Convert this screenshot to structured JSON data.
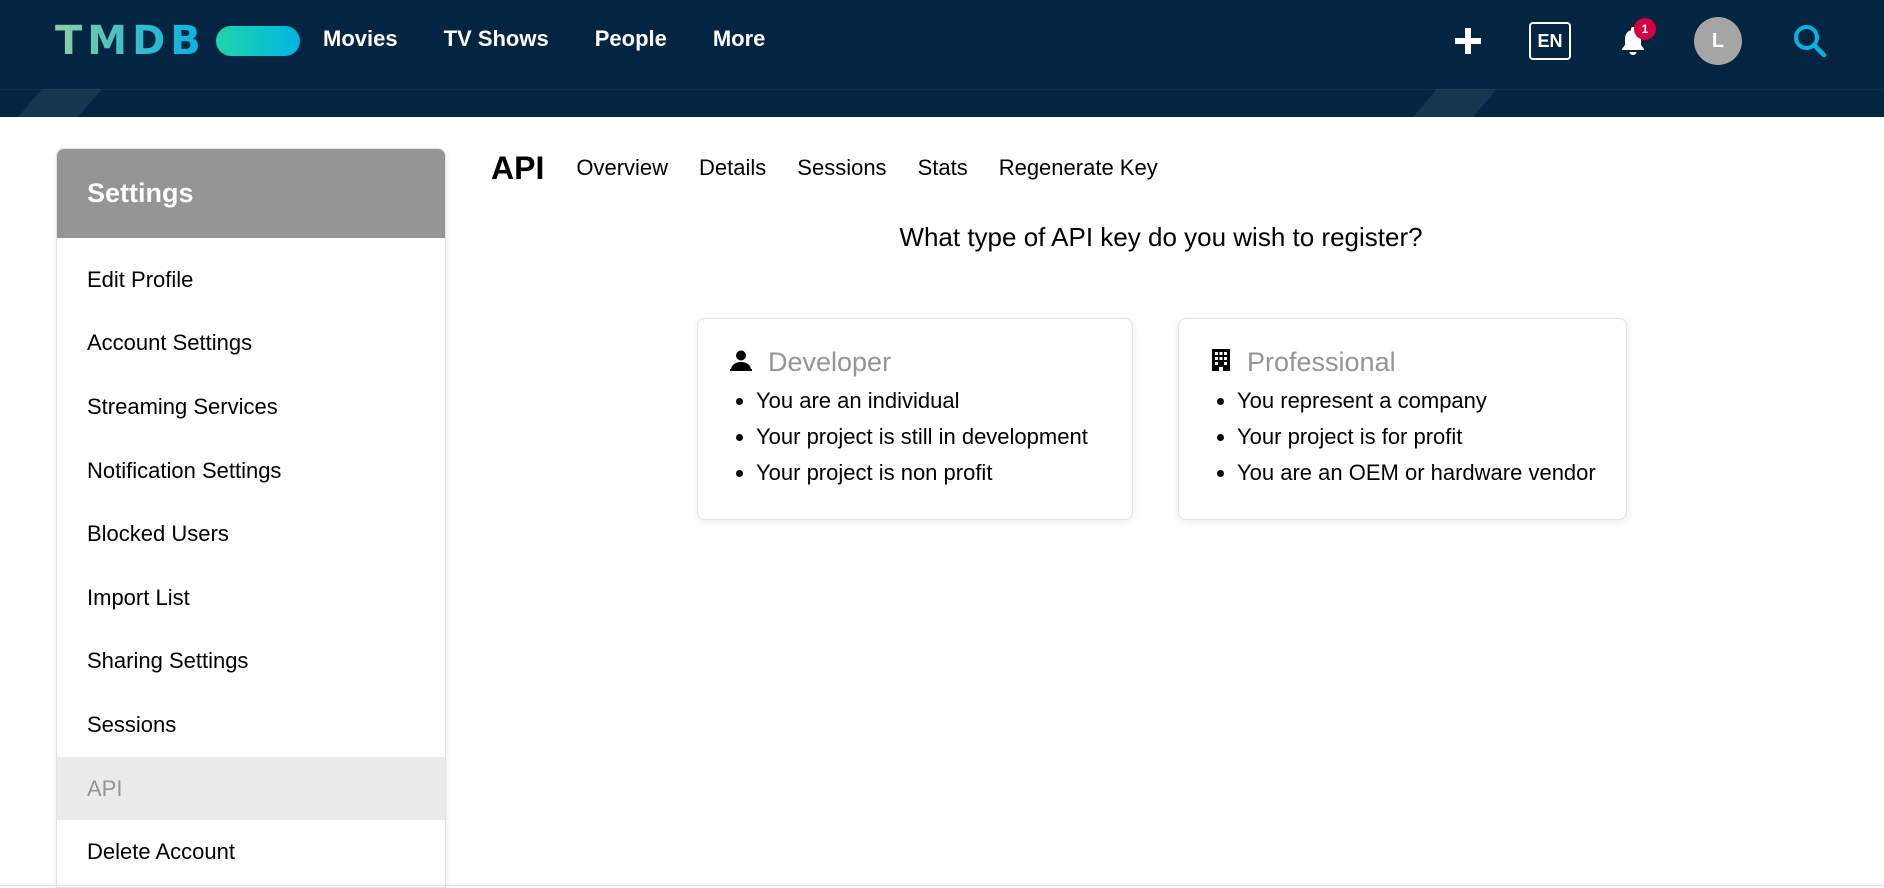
{
  "header": {
    "logo_text": "TMDB",
    "nav": [
      "Movies",
      "TV Shows",
      "People",
      "More"
    ],
    "language": "EN",
    "notification_count": "1",
    "avatar_initial": "L"
  },
  "sidebar": {
    "title": "Settings",
    "items": [
      {
        "label": "Edit Profile",
        "active": false
      },
      {
        "label": "Account Settings",
        "active": false
      },
      {
        "label": "Streaming Services",
        "active": false
      },
      {
        "label": "Notification Settings",
        "active": false
      },
      {
        "label": "Blocked Users",
        "active": false
      },
      {
        "label": "Import List",
        "active": false
      },
      {
        "label": "Sharing Settings",
        "active": false
      },
      {
        "label": "Sessions",
        "active": false
      },
      {
        "label": "API",
        "active": true
      },
      {
        "label": "Delete Account",
        "active": false
      }
    ]
  },
  "main": {
    "title": "API",
    "tabs": [
      "Overview",
      "Details",
      "Sessions",
      "Stats",
      "Regenerate Key"
    ],
    "question": "What type of API key do you wish to register?",
    "cards": {
      "developer": {
        "title": "Developer",
        "icon": "person-icon",
        "points": [
          "You are an individual",
          "Your project is still in development",
          "Your project is non profit"
        ]
      },
      "professional": {
        "title": "Professional",
        "icon": "building-icon",
        "points": [
          "You represent a company",
          "Your project is for profit",
          "You are an OEM or hardware vendor"
        ]
      }
    }
  },
  "colors": {
    "header_bg": "#032541",
    "accent": "#01b4e4",
    "sidebar_title_bg": "#959595",
    "badge": "#d40242"
  }
}
